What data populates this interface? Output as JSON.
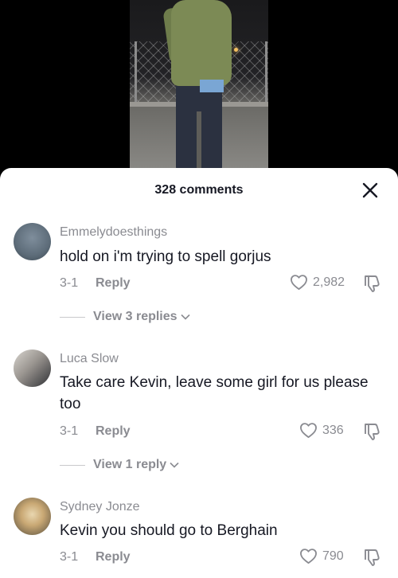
{
  "header": {
    "comment_count": "328 comments"
  },
  "icons": {
    "close": "close-icon",
    "like": "heart-icon",
    "dislike": "thumbs-down-icon",
    "expand": "chevron-down-icon"
  },
  "colors": {
    "primary_text": "#161823",
    "secondary_text": "#8a8b91",
    "sheet_bg": "#ffffff"
  },
  "comments": [
    {
      "username": "Emmelydoesthings",
      "text": "hold on i'm trying to spell gorjus",
      "date": "3-1",
      "reply_label": "Reply",
      "likes": "2,982",
      "view_replies": "View 3 replies"
    },
    {
      "username": "Luca Slow",
      "text": "Take care Kevin, leave some girl for us please too",
      "date": "3-1",
      "reply_label": "Reply",
      "likes": "336",
      "view_replies": "View 1 reply"
    },
    {
      "username": "Sydney Jonze",
      "text": "Kevin you should go to Berghain",
      "date": "3-1",
      "reply_label": "Reply",
      "likes": "790"
    }
  ]
}
